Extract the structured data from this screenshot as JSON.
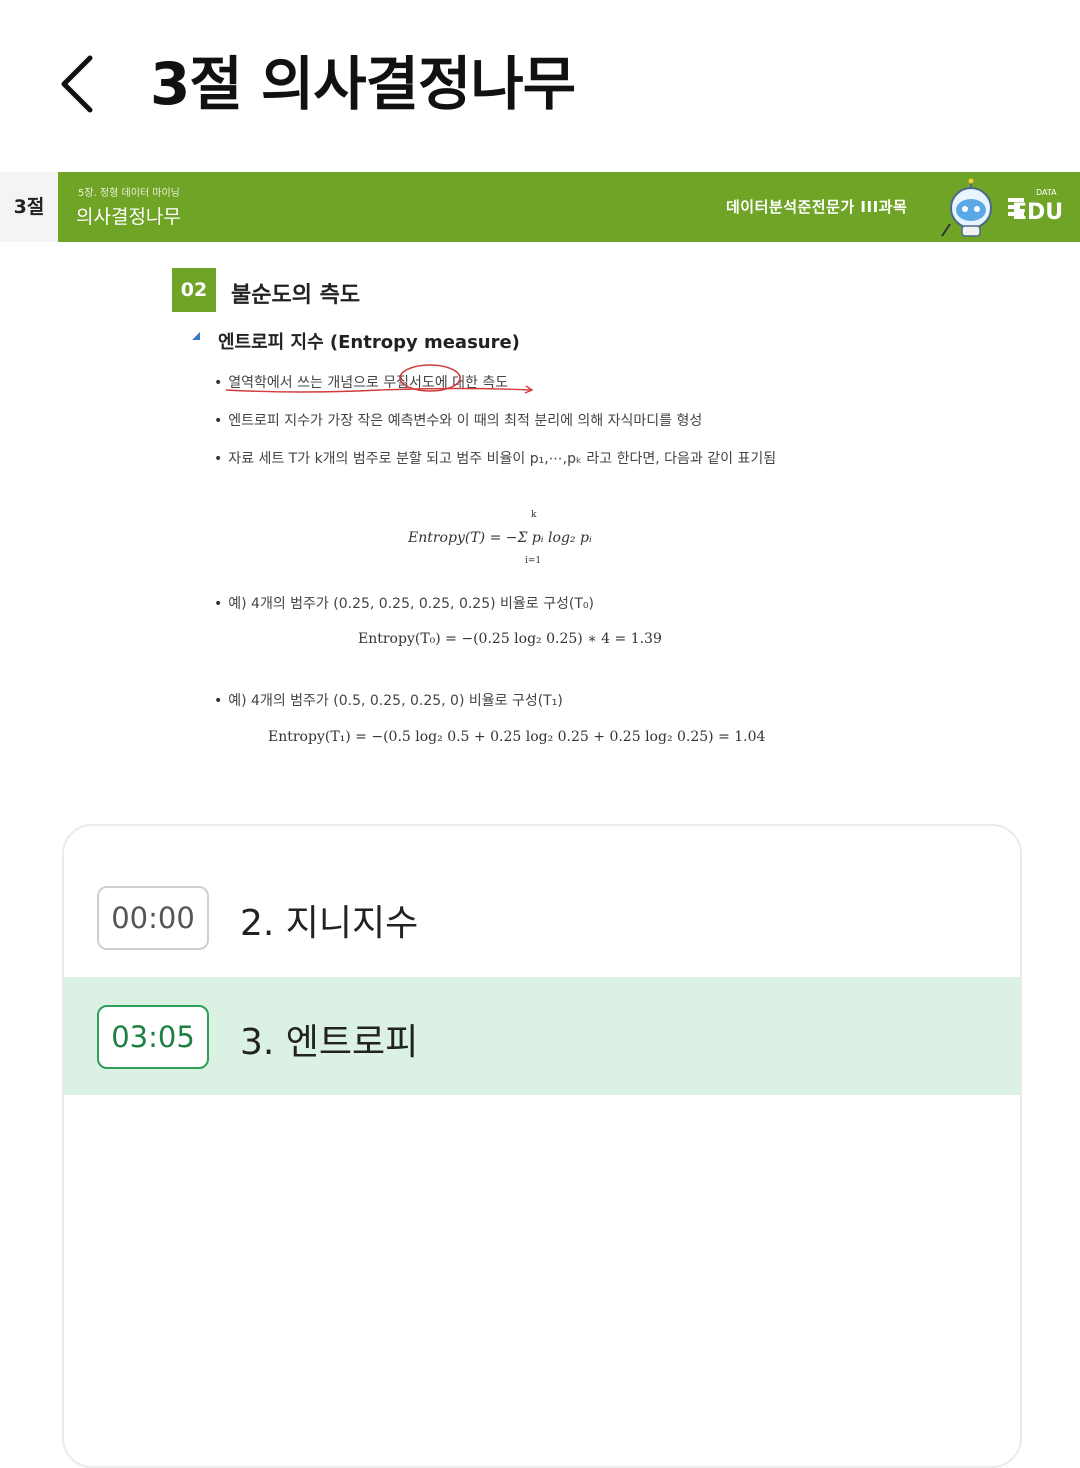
{
  "header": {
    "back_icon": "chevron-left-icon",
    "title": "3절 의사결정나무"
  },
  "slide": {
    "chapter_tab": "3절",
    "band_subtitle": "5장. 정형 데이터 마이닝",
    "band_title": "의사결정나무",
    "course_label": "데이터분석준전문가 III과목",
    "logo_text": "EDU",
    "logo_small": "DATA",
    "brand_color": "#6fa426",
    "section_number": "02",
    "section_title": "불순도의 측도",
    "subheading": "엔트로피 지수 (Entropy measure)",
    "bullets": [
      "열역학에서 쓰는 개념으로 무질서도에 대한 측도",
      "엔트로피 지수가 가장 작은 예측변수와 이 때의 최적 분리에 의해 자식마디를 형성",
      "자료 세트 T가 k개의 범주로 분할 되고 범주 비율이 p₁,⋯,pₖ 라고 한다면, 다음과 같이 표기됨"
    ],
    "formula_main": "Entropy(T) = −Σ pᵢ log₂ pᵢ",
    "formula_sum_top": "k",
    "formula_sum_bottom": "i=1",
    "example1": "예) 4개의 범주가 (0.25, 0.25, 0.25, 0.25) 비율로 구성(T₀)",
    "example1_formula": "Entropy(T₀) = −(0.25 log₂ 0.25) ∗ 4 = 1.39",
    "example2": "예) 4개의 범주가 (0.5, 0.25, 0.25, 0) 비율로 구성(T₁)",
    "example2_formula": "Entropy(T₁) = −(0.5 log₂ 0.5 + 0.25 log₂ 0.25 + 0.25 log₂ 0.25) = 1.04"
  },
  "chapters": [
    {
      "time": "00:00",
      "label": "2. 지니지수",
      "active": false
    },
    {
      "time": "03:05",
      "label": "3. 엔트로피",
      "active": true
    }
  ],
  "colors": {
    "active_row": "#daf1e4",
    "active_accent": "#2f9e57"
  }
}
